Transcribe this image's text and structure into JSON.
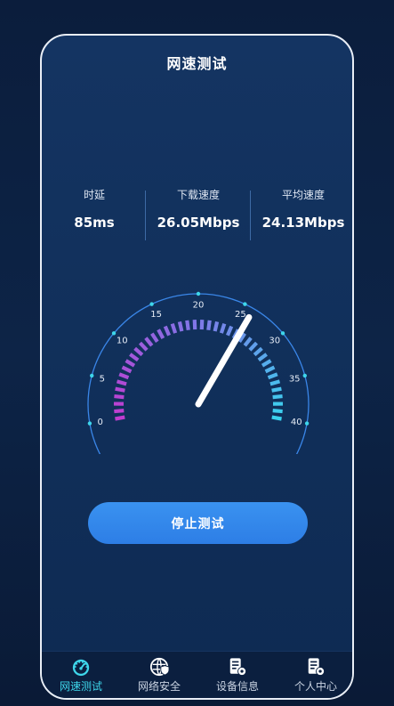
{
  "header": {
    "title": "网速测试"
  },
  "stats": [
    {
      "label": "时延",
      "value": "85ms"
    },
    {
      "label": "下载速度",
      "value": "26.05Mbps"
    },
    {
      "label": "平均速度",
      "value": "24.13Mbps"
    }
  ],
  "gauge": {
    "ticks": [
      "0",
      "5",
      "10",
      "15",
      "20",
      "25",
      "30",
      "35",
      "40"
    ],
    "min": 0,
    "max": 40,
    "current": 26.05,
    "colors": {
      "start": "#c03ccf",
      "mid": "#7f78e8",
      "end": "#3ad2ee",
      "arc": "#3a86e8"
    }
  },
  "actions": {
    "stop_label": "停止测试"
  },
  "tabs": [
    {
      "label": "网速测试",
      "icon": "speedometer-icon",
      "active": true
    },
    {
      "label": "网络安全",
      "icon": "shield-icon",
      "active": false
    },
    {
      "label": "设备信息",
      "icon": "device-settings-icon",
      "active": false
    },
    {
      "label": "个人中心",
      "icon": "user-settings-icon",
      "active": false
    }
  ]
}
